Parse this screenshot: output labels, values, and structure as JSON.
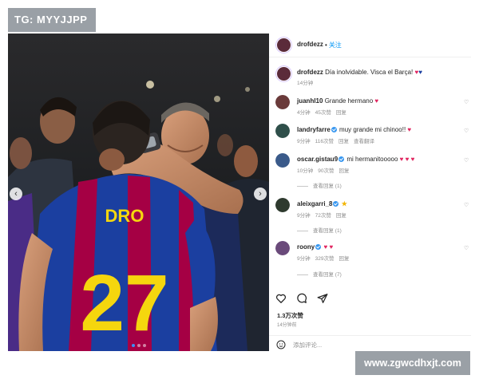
{
  "watermark_top": "TG: MYYJJPP",
  "watermark_bottom": "www.zgwcdhxjt.com",
  "post": {
    "author": "drofdezz",
    "follow_label": "关注",
    "caption_text": "Día inolvidable. Visca el Barça! ",
    "caption_time": "14分钟",
    "jersey_name": "DRO",
    "jersey_number": "27",
    "likes": "1.3万次赞",
    "time_ago": "14分钟前",
    "add_comment_placeholder": "添加评论..."
  },
  "comments": [
    {
      "user": "juanhl10",
      "verified": false,
      "text": "Grande hermano ",
      "time": "4分钟",
      "likes": "45次赞",
      "reply": "回复",
      "view_replies": ""
    },
    {
      "user": "landryfarre",
      "verified": true,
      "text": "muy grande mi chinoo!! ",
      "time": "9分钟",
      "likes": "116次赞",
      "reply": "回复",
      "view_replies": "查看翻译"
    },
    {
      "user": "oscar.gistau9",
      "verified": true,
      "text": "mi hermanitooooo ",
      "time": "10分钟",
      "likes": "90次赞",
      "reply": "回复",
      "view_replies": "查看回复 (1)"
    },
    {
      "user": "aleixgarri_8",
      "verified": true,
      "text": "",
      "time": "9分钟",
      "likes": "72次赞",
      "reply": "回复",
      "view_replies": "查看回复 (1)"
    },
    {
      "user": "roony",
      "verified": true,
      "text": "",
      "time": "9分钟",
      "likes": "329次赞",
      "reply": "回复",
      "view_replies": "查看回复 (7)"
    }
  ],
  "icons": {
    "like": "heart-icon",
    "comment": "comment-icon",
    "share": "share-icon",
    "emoji": "emoji-icon",
    "verified": "verified-badge-icon"
  },
  "colors": {
    "link_blue": "#0095f6",
    "verified_blue": "#3897f0",
    "heart_red": "#e0245e",
    "barca_blue": "#1b3fa0",
    "barca_red": "#a50044",
    "jersey_yellow": "#f5d60e"
  }
}
